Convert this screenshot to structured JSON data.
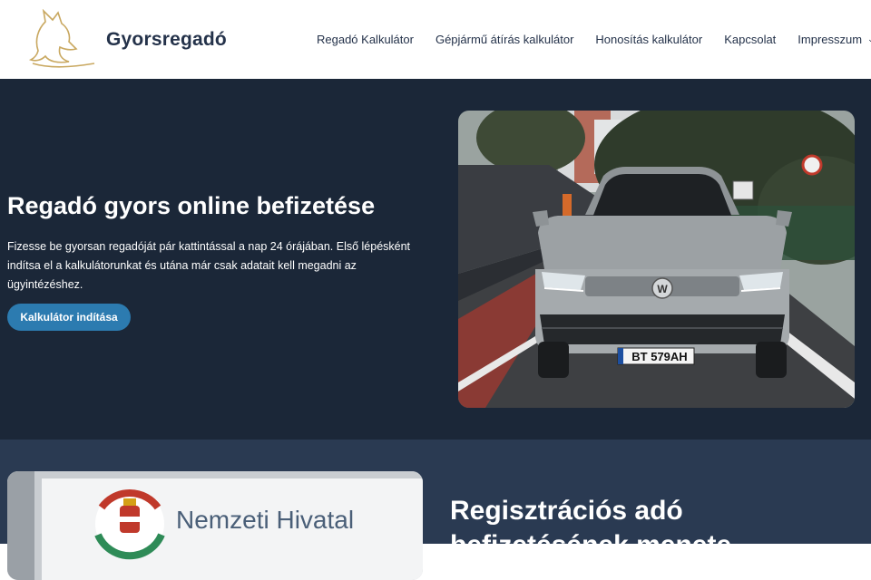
{
  "header": {
    "brand": "Gyorsregadó",
    "nav": [
      {
        "label": "Regadó Kalkulátor"
      },
      {
        "label": "Gépjármű átírás kalkulátor"
      },
      {
        "label": "Honosítás kalkulátor"
      },
      {
        "label": "Kapcsolat"
      },
      {
        "label": "Impresszum",
        "has_dropdown": true
      }
    ]
  },
  "hero": {
    "title": "Regadó gyors online befizetése",
    "text": "Fizesse be gyorsan regadóját pár kattintással a nap 24 órájában. Első lépésként indítsa el a kalkulátorunkat és utána már csak adatait kell megadni az ügyintézéshez.",
    "button": "Kalkulátor indítása",
    "image": {
      "plate": "BT 579AH"
    }
  },
  "section2": {
    "title": "Regisztrációs adó befizetésének menete",
    "image": {
      "sign": "Nemzeti Hivatal"
    }
  },
  "colors": {
    "header_bg": "#ffffff",
    "hero_bg": "#1b2738",
    "section2_bg": "#2a3a52",
    "button_bg": "#2c7bb0",
    "logo_gold": "#c9a860"
  }
}
